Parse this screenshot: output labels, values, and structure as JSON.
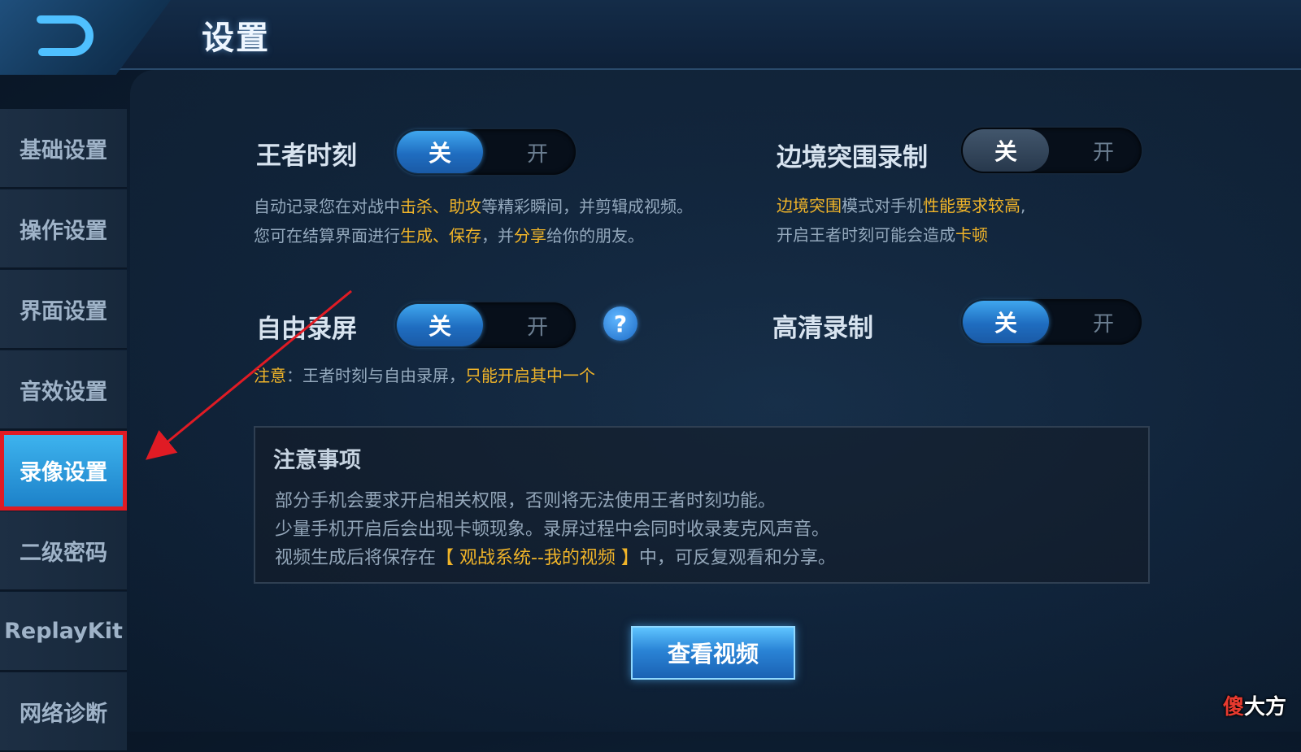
{
  "header": {
    "title": "设置"
  },
  "sidebar": {
    "items": [
      {
        "label": "基础设置",
        "active": false
      },
      {
        "label": "操作设置",
        "active": false
      },
      {
        "label": "界面设置",
        "active": false
      },
      {
        "label": "音效设置",
        "active": false
      },
      {
        "label": "录像设置",
        "active": true
      },
      {
        "label": "二级密码",
        "active": false
      },
      {
        "label": "ReplayKit",
        "active": false
      },
      {
        "label": "网络诊断",
        "active": false
      }
    ]
  },
  "settings": {
    "wangzhe": {
      "label": "王者时刻",
      "off": "关",
      "on": "开",
      "state": "off",
      "desc_line1": [
        "自动记录您在对战中",
        "击杀",
        "、",
        "助攻",
        "等精彩瞬间，并剪辑成视频。"
      ],
      "desc_line2": [
        "您可在结算界面进行",
        "生成",
        "、",
        "保存",
        "，并",
        "分享",
        "给你的朋友。"
      ]
    },
    "border": {
      "label": "边境突围录制",
      "off": "关",
      "on": "开",
      "state": "off",
      "desc_line1": [
        "边境突围",
        "模式对手机",
        "性能要求较高",
        ","
      ],
      "desc_line2": [
        "开启王者时刻可能会造成",
        "卡顿"
      ]
    },
    "free": {
      "label": "自由录屏",
      "off": "关",
      "on": "开",
      "state": "off",
      "help": "?",
      "note": [
        "注意",
        "：王者时刻与自由录屏，",
        "只能开启其中一个"
      ]
    },
    "hd": {
      "label": "高清录制",
      "off": "关",
      "on": "开",
      "state": "off"
    }
  },
  "notice": {
    "title": "注意事项",
    "line1": "部分手机会要求开启相关权限，否则将无法使用王者时刻功能。",
    "line2": "少量手机开启后会出现卡顿现象。录屏过程中会同时收录麦克风声音。",
    "line3": [
      "视频生成后将保存在",
      "【 观战系统--我的视频 】",
      "中，可反复观看和分享。"
    ]
  },
  "view_button": "查看视频",
  "watermark": {
    "first": "傻",
    "rest": "大方"
  },
  "colors": {
    "accent": "#2a84d6",
    "highlight": "#f0b429",
    "annotation": "#e01b24"
  }
}
